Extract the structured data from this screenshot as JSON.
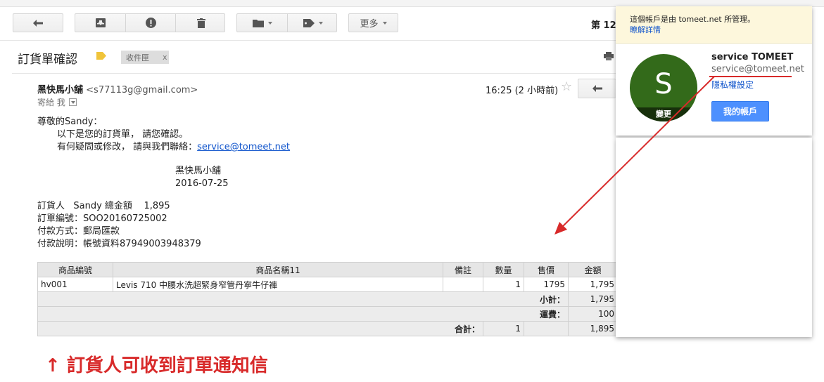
{
  "toolbar": {
    "more_label": "更多",
    "page_counter": "第 12"
  },
  "email": {
    "subject": "訂貨單確認",
    "label_tag": "收件匣",
    "label_close": "x",
    "sender_name": "黑快馬小舖",
    "sender_email": "<s77113g@gmail.com>",
    "recipient": "寄給 我",
    "timestamp": "16:25 (2 小時前)",
    "body": {
      "greeting": "尊敬的Sandy：",
      "line1": "以下是您的訂貨單， 請您確認。",
      "line2_prefix": "有何疑問或修改， 請與我們聯絡：",
      "contact_link": "service@tomeet.net",
      "shop_name": "黑快馬小舖",
      "date": "2016-07-25",
      "orderer_line": "訂貨人   Sandy 總金額    1,895",
      "order_no": "訂單編號：SOO20160725002",
      "payment_method": "付款方式：郵局匯款",
      "payment_note": "付款說明：帳號資料87949003948379"
    },
    "table": {
      "headers": [
        "商品編號",
        "商品名稱11",
        "備註",
        "數量",
        "售價",
        "金額"
      ],
      "rows": [
        [
          "hv001",
          "Levis 710 中腰水洗超緊身窄管丹寧牛仔褲",
          "",
          "1",
          "1795",
          "1,795"
        ]
      ],
      "subtotal_label": "小計：",
      "subtotal_value": "1,795",
      "shipping_label": "運費：",
      "shipping_value": "100",
      "total_label": "合計：",
      "total_qty": "1",
      "total_value": "1,895"
    }
  },
  "annotation": {
    "caption": "↑ 訂貨人可收到訂單通知信",
    "color": "#d82a2a"
  },
  "account_popup": {
    "managed_notice": "這個帳戶是由 tomeet.net 所管理。",
    "learn_more": "瞭解詳情",
    "avatar_letter": "S",
    "avatar_change": "變更",
    "avatar_color": "#336a1a",
    "name": "service TOMEET",
    "email": "service@tomeet.net",
    "privacy": "隱私權設定",
    "my_account_button": "我的帳戶",
    "button_color": "#4d90fe"
  }
}
